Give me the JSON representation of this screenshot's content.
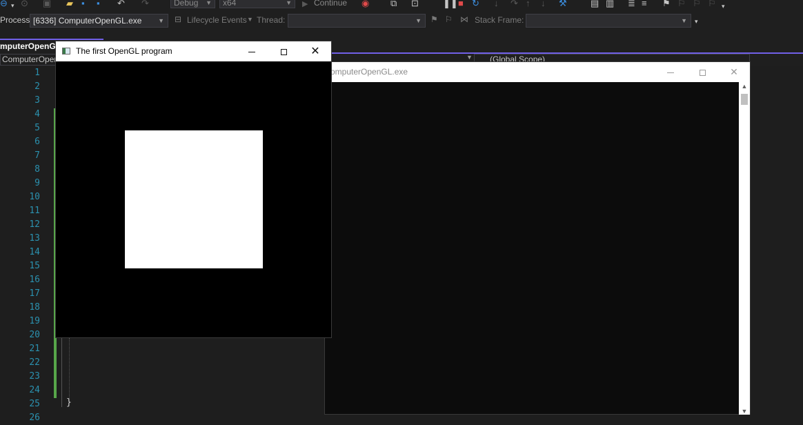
{
  "toolbar": {
    "config_value": "Debug",
    "platform_value": "x64",
    "continue_label": "Continue"
  },
  "debug_bar": {
    "process_label": "Process:",
    "process_value": "[6336] ComputerOpenGL.exe",
    "lifecycle_label": "Lifecycle Events",
    "thread_label": "Thread:",
    "stack_frame_label": "Stack Frame:"
  },
  "editor": {
    "tab_label": "mputerOpenGl",
    "nav_project": "ComputerOpen",
    "nav_scope": "(Global Scope)",
    "line_numbers": [
      "1",
      "2",
      "3",
      "4",
      "5",
      "6",
      "7",
      "8",
      "9",
      "10",
      "11",
      "12",
      "13",
      "14",
      "15",
      "16",
      "17",
      "18",
      "19",
      "20",
      "21",
      "22",
      "23",
      "24",
      "25",
      "26"
    ],
    "closing_brace": "}"
  },
  "console_window": {
    "title": "omputerOpenGL.exe"
  },
  "gl_window": {
    "title": "The first OpenGL program",
    "square_color": "#ffffff",
    "background_color": "#000000"
  },
  "colors": {
    "accent": "#7160e8",
    "change_bar": "#57a64a",
    "line_number": "#2b91af"
  }
}
